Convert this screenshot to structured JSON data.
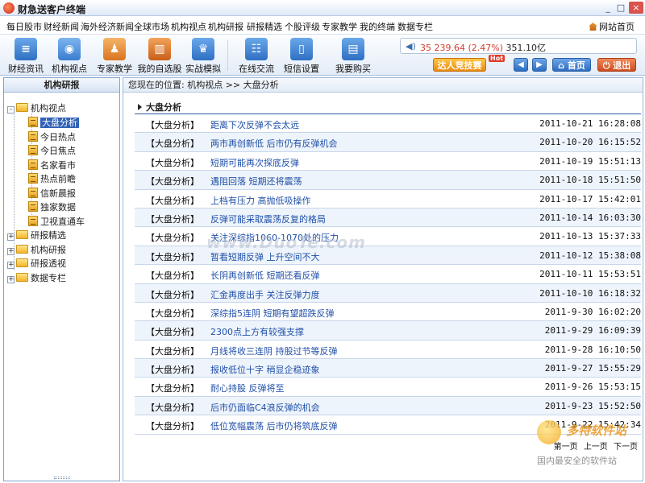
{
  "window": {
    "title": "财急送客户终端",
    "min": "_",
    "max": "□",
    "close": "×"
  },
  "menu": {
    "items": [
      "每日股市",
      "财经新闻",
      "海外经济新闻",
      "全球市场",
      "机构视点",
      "机构研报",
      "研报精选",
      "个股评级",
      "专家教学",
      "我的终端",
      "数据专栏"
    ],
    "home_link": "网站首页"
  },
  "toolbar": {
    "buttons": [
      {
        "label": "财经资讯",
        "icon": "finance-news-icon",
        "color": "#3d7fd1"
      },
      {
        "label": "机构视点",
        "icon": "eye-icon",
        "color": "#4a8fd8"
      },
      {
        "label": "专家教学",
        "icon": "teacher-icon",
        "color": "#e88a2e"
      },
      {
        "label": "我的自选股",
        "icon": "stock-chart-icon",
        "color": "#2f9d4c"
      },
      {
        "label": "实战模拟",
        "icon": "crown-icon",
        "color": "#3873c8"
      },
      {
        "label": "在线交流",
        "icon": "chat-icon",
        "color": "#3a78c9"
      },
      {
        "label": "短信设置",
        "icon": "phone-icon",
        "color": "#3a78c9"
      },
      {
        "label": "我要购买",
        "icon": "cart-icon",
        "color": "#3a78c9"
      }
    ],
    "ticker": {
      "text": "35 239.64 (2.47%) ",
      "amount": "351.10亿"
    },
    "contest_button": "达人竞技赛",
    "hot_tag": "Hot",
    "home_button": "首页",
    "exit_button": "退出"
  },
  "sidebar": {
    "title": "机构研报",
    "tree": [
      {
        "label": "机构视点",
        "type": "folder",
        "expand": "-",
        "children": [
          "大盘分析",
          "今日热点",
          "今日焦点",
          "名家看市",
          "热点前瞻",
          "信新晨报",
          "独家数据",
          "卫视直通车"
        ]
      },
      {
        "label": "研报精选",
        "type": "folder",
        "expand": "+"
      },
      {
        "label": "机构研报",
        "type": "folder",
        "expand": "+"
      },
      {
        "label": "研报透视",
        "type": "folder",
        "expand": "+"
      },
      {
        "label": "数据专栏",
        "type": "folder",
        "expand": "+"
      }
    ],
    "selected": "大盘分析"
  },
  "main": {
    "breadcrumb": "您现在的位置: 机构视点 >> 大盘分析",
    "section_title": "大盘分析",
    "rows": [
      {
        "category": "【大盘分析】",
        "title": "距离下次反弹不会太远",
        "date": "2011-10-21 16:28:08"
      },
      {
        "category": "【大盘分析】",
        "title": "两市再创新低 后市仍有反弹机会",
        "date": "2011-10-20 16:15:52"
      },
      {
        "category": "【大盘分析】",
        "title": "短期可能再次探底反弹",
        "date": "2011-10-19 15:51:13"
      },
      {
        "category": "【大盘分析】",
        "title": "遇阻回落 短期还将震荡",
        "date": "2011-10-18 15:51:50"
      },
      {
        "category": "【大盘分析】",
        "title": "上档有压力 高抛低吸操作",
        "date": "2011-10-17 15:42:01"
      },
      {
        "category": "【大盘分析】",
        "title": "反弹可能采取震荡反复的格局",
        "date": "2011-10-14 16:03:30"
      },
      {
        "category": "【大盘分析】",
        "title": "关注深综指1060-1070处的压力",
        "date": "2011-10-13 15:37:33"
      },
      {
        "category": "【大盘分析】",
        "title": "暂看短期反弹 上升空间不大",
        "date": "2011-10-12 15:38:08"
      },
      {
        "category": "【大盘分析】",
        "title": "长阴再创新低 短期还看反弹",
        "date": "2011-10-11 15:53:51"
      },
      {
        "category": "【大盘分析】",
        "title": "汇金再度出手 关注反弹力度",
        "date": "2011-10-10 16:18:32"
      },
      {
        "category": "【大盘分析】",
        "title": "深综指5连阴 短期有望超跌反弹",
        "date": "2011-9-30 16:02:20"
      },
      {
        "category": "【大盘分析】",
        "title": "2300点上方有较强支撑",
        "date": "2011-9-29 16:09:39"
      },
      {
        "category": "【大盘分析】",
        "title": "月线将收三连阴 持股过节等反弹",
        "date": "2011-9-28 16:10:50"
      },
      {
        "category": "【大盘分析】",
        "title": "报收低位十字 稍显企稳迹象",
        "date": "2011-9-27 15:55:29"
      },
      {
        "category": "【大盘分析】",
        "title": "耐心持股 反弹将至",
        "date": "2011-9-26 15:53:15"
      },
      {
        "category": "【大盘分析】",
        "title": "后市仍面临C4浪反弹的机会",
        "date": "2011-9-23 15:52:50"
      },
      {
        "category": "【大盘分析】",
        "title": "低位宽幅震荡 后市仍将筑底反弹",
        "date": "2011-9-22 15:42:34"
      }
    ],
    "pager": {
      "first": "第一页",
      "prev": "上一页",
      "next": "下一页"
    }
  },
  "watermarks": {
    "center": "www.DuoTe.com",
    "brand": "多特软件站",
    "slogan": "国内最安全的软件站"
  }
}
